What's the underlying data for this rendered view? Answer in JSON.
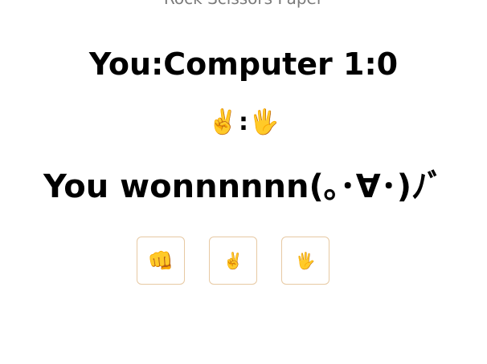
{
  "header": {
    "cut_title": "Rock Scissors Paper"
  },
  "score": {
    "text": "You:Computer 1:0"
  },
  "matchup": {
    "player_icon": "✌️",
    "separator": ":",
    "computer_icon": "🖐"
  },
  "result": {
    "text": "You wonnnnnn(｡･∀･)ﾉﾞ"
  },
  "choices": [
    {
      "name": "rock",
      "icon": "👊"
    },
    {
      "name": "scissors",
      "icon": "✌️"
    },
    {
      "name": "paper",
      "icon": "🖐"
    }
  ],
  "colors": {
    "button_border": "#e7c9a3",
    "text": "#000000"
  }
}
